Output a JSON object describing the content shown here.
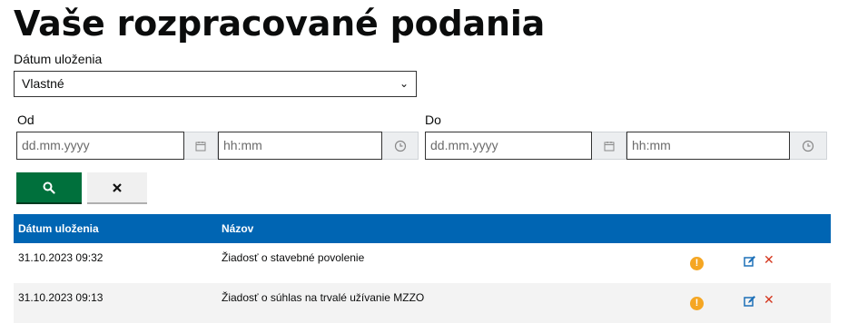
{
  "page_title": "Vaše rozpracované podania",
  "filter": {
    "date_label": "Dátum uloženia",
    "date_select_value": "Vlastné",
    "from_label": "Od",
    "to_label": "Do",
    "from_date_placeholder": "dd.mm.yyyy",
    "from_time_placeholder": "hh:mm",
    "to_date_placeholder": "dd.mm.yyyy",
    "to_time_placeholder": "hh:mm"
  },
  "buttons": {
    "search_icon": "search-icon",
    "clear_icon": "close-icon"
  },
  "table": {
    "headers": [
      "Dátum uloženia",
      "Názov"
    ],
    "rows": [
      {
        "date": "31.10.2023 09:32",
        "name": "Žiadosť o stavebné povolenie"
      },
      {
        "date": "31.10.2023 09:13",
        "name": "Žiadosť o súhlas na trvalé užívanie MZZO"
      }
    ]
  },
  "colors": {
    "header_bg": "#0065b3",
    "search_btn": "#00703c",
    "warning": "#f5a623",
    "delete": "#d4351c",
    "edit": "#1d70b8"
  }
}
